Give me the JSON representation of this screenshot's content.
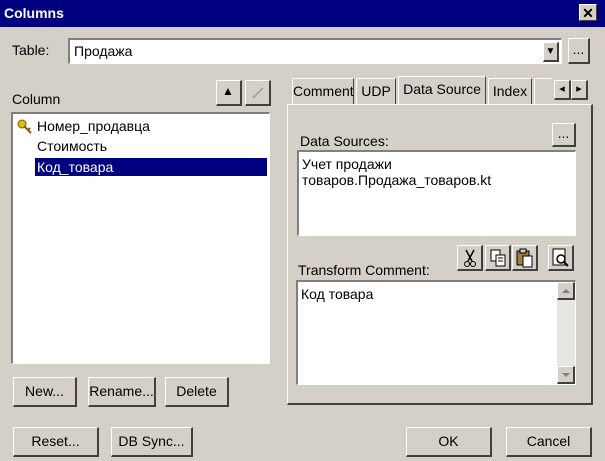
{
  "window": {
    "title": "Columns",
    "close_glyph": "✕"
  },
  "table": {
    "label": "Table:",
    "value": "Продажа",
    "browse_label": "...",
    "dropdown_glyph": "▼"
  },
  "column": {
    "label": "Column",
    "up_glyph": "▲",
    "items": [
      {
        "label": "Номер_продавца",
        "key": true,
        "selected": false
      },
      {
        "label": "Стоимость",
        "key": false,
        "selected": false
      },
      {
        "label": "Код_товара",
        "key": false,
        "selected": true
      }
    ]
  },
  "tabs": [
    {
      "label": "Comment",
      "active": false
    },
    {
      "label": "UDP",
      "active": false
    },
    {
      "label": "Data Source",
      "active": true
    },
    {
      "label": "Index",
      "active": false
    }
  ],
  "tab_scroll": {
    "left": "◂",
    "right": "▸"
  },
  "data_sources": {
    "label": "Data Sources:",
    "browse_label": "...",
    "value": "Учет продажи товаров.Продажа_товаров.kt"
  },
  "transform_comment": {
    "label": "Transform Comment:",
    "value": "Код товара",
    "tool_icons": [
      "cut-icon",
      "copy-icon",
      "paste-icon",
      "find-icon"
    ]
  },
  "buttons": {
    "new": "New...",
    "rename": "Rename...",
    "delete": "Delete",
    "reset": "Reset...",
    "db_sync": "DB Sync...",
    "ok": "OK",
    "cancel": "Cancel"
  },
  "colors": {
    "titlebar": "#000080",
    "face": "#d4d0c8",
    "selection": "#000080"
  }
}
